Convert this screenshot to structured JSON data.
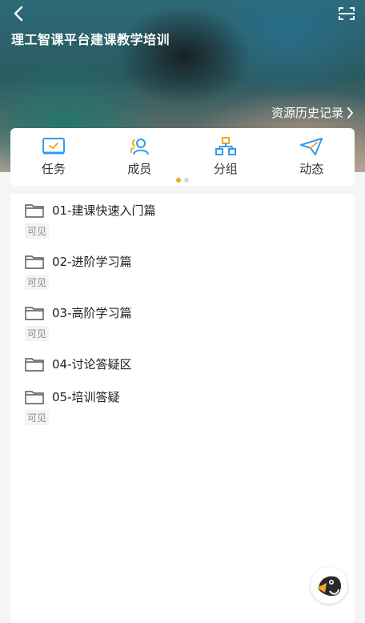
{
  "header": {
    "back_icon": "chevron-left-icon",
    "scan_icon": "scan-icon",
    "title": "理工智课平台建课教学培训",
    "history_link": "资源历史记录",
    "history_icon": "chevron-right-icon"
  },
  "tools": [
    {
      "label": "任务",
      "icon": "task-check-icon",
      "color": "#2f9cf0"
    },
    {
      "label": "成员",
      "icon": "members-icon",
      "color": "#2f9cf0"
    },
    {
      "label": "分组",
      "icon": "group-icon",
      "color": "#2f9cf0"
    },
    {
      "label": "动态",
      "icon": "paper-plane-icon",
      "color": "#2f9cf0"
    }
  ],
  "pager": {
    "active": 1,
    "total": 2,
    "active_color": "#f5a623"
  },
  "folders": [
    {
      "name": "01-建课快速入门篇",
      "badge": "可见"
    },
    {
      "name": "02-进阶学习篇",
      "badge": "可见"
    },
    {
      "name": "03-高阶学习篇",
      "badge": "可见"
    },
    {
      "name": "04-讨论答疑区",
      "badge": ""
    },
    {
      "name": "05-培训答疑",
      "badge": "可见"
    }
  ],
  "assistant": {
    "icon": "assistant-bird-icon"
  }
}
